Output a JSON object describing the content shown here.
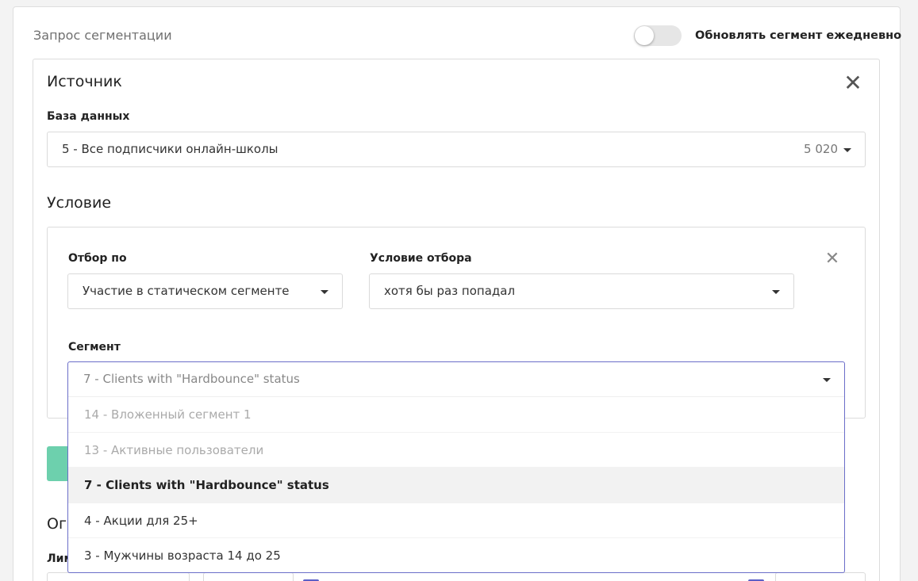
{
  "header": {
    "title": "Запрос сегментации",
    "toggle_label": "Обновлять сегмент ежедневно",
    "toggle_on": false
  },
  "source": {
    "title": "Источник",
    "database_label": "База данных",
    "database_value": "5 - Все подписчики онлайн-школы",
    "database_count": "5 020"
  },
  "condition": {
    "title": "Условие",
    "filter_by_label": "Отбор по",
    "filter_by_value": "Участие в статическом сегменте",
    "filter_condition_label": "Условие отбора",
    "filter_condition_value": "хотя бы раз попадал",
    "segment_label": "Сегмент",
    "segment_value": "7 - Clients with \"Hardbounce\" status",
    "segment_options": [
      {
        "label": "14 - Вложенный сегмент 1",
        "state": "disabled"
      },
      {
        "label": "13 - Активные пользователи",
        "state": "disabled"
      },
      {
        "label": "7 - Clients with \"Hardbounce\" status",
        "state": "active"
      },
      {
        "label": "4 - Акции для 25+",
        "state": "normal"
      },
      {
        "label": "3 - Мужчины возраста 14 до 25",
        "state": "normal"
      }
    ]
  },
  "limits": {
    "title_partial": "Ог",
    "label_partial": "Лим"
  },
  "colors": {
    "accent": "#6b6ec9",
    "green": "#6dd0ad"
  }
}
